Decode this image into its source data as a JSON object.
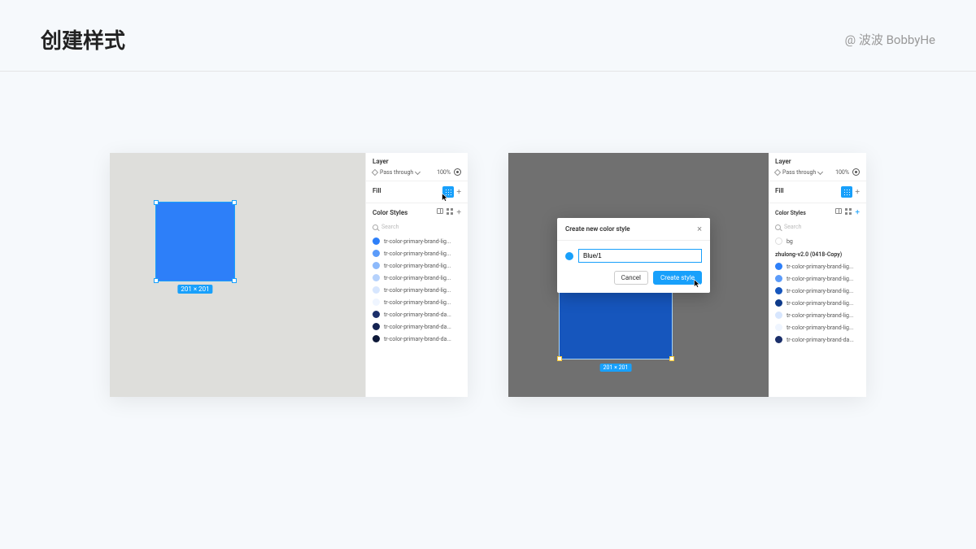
{
  "header": {
    "title": "创建样式",
    "credit": "@ 波波 BobbyHe"
  },
  "shot1": {
    "dim_badge": "201 × 201",
    "panel": {
      "layer_section": "Layer",
      "blend_mode": "Pass through",
      "opacity": "100%",
      "fill_section": "Fill",
      "styles_header": "Color Styles",
      "search_placeholder": "Search",
      "styles": [
        {
          "color": "#2d7ff9",
          "label": "tr-color-primary-brand-lig..."
        },
        {
          "color": "#5b9bfa",
          "label": "tr-color-primary-brand-lig..."
        },
        {
          "color": "#8cb9fb",
          "label": "tr-color-primary-brand-lig..."
        },
        {
          "color": "#b6d2fc",
          "label": "tr-color-primary-brand-lig..."
        },
        {
          "color": "#d7e6fe",
          "label": "tr-color-primary-brand-lig..."
        },
        {
          "color": "#eff5ff",
          "label": "tr-color-primary-brand-lig..."
        },
        {
          "color": "#1b2f6a",
          "label": "tr-color-primary-brand-da..."
        },
        {
          "color": "#142351",
          "label": "tr-color-primary-brand-da..."
        },
        {
          "color": "#0d1838",
          "label": "tr-color-primary-brand-da..."
        }
      ]
    }
  },
  "shot2": {
    "dim_badge": "201 × 201",
    "modal": {
      "title": "Create new color style",
      "input_value": "Blue/1",
      "cancel": "Cancel",
      "create": "Create style"
    },
    "panel": {
      "layer_section": "Layer",
      "blend_mode": "Pass through",
      "opacity": "100%",
      "fill_section": "Fill",
      "styles_header": "Color Styles",
      "search_placeholder": "Search",
      "bg_item": "bg",
      "lib_name": "zhulong-v2.0 (0418-Copy)",
      "styles": [
        {
          "color": "#2d7ff9",
          "label": "tr-color-primary-brand-lig..."
        },
        {
          "color": "#5b9bfa",
          "label": "tr-color-primary-brand-lig..."
        },
        {
          "color": "#1656bd",
          "label": "tr-color-primary-brand-lig..."
        },
        {
          "color": "#0d3a8a",
          "label": "tr-color-primary-brand-lig..."
        },
        {
          "color": "#d7e6fe",
          "label": "tr-color-primary-brand-lig..."
        },
        {
          "color": "#eff5ff",
          "label": "tr-color-primary-brand-lig..."
        },
        {
          "color": "#1b2f6a",
          "label": "tr-color-primary-brand-da..."
        }
      ]
    }
  }
}
